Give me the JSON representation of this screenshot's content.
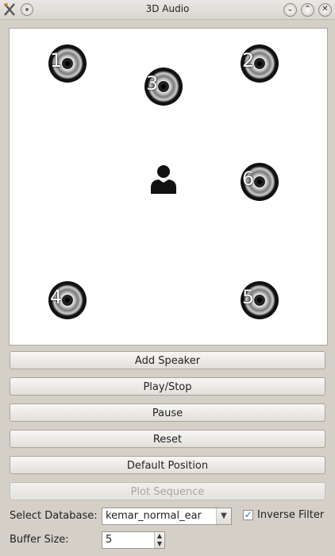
{
  "window": {
    "title": "3D Audio",
    "buttons": {
      "minimize": "⌄",
      "maximize": "⌃",
      "close": "✕"
    }
  },
  "canvas": {
    "speakers": [
      {
        "label": "1"
      },
      {
        "label": "2"
      },
      {
        "label": "3"
      },
      {
        "label": "4"
      },
      {
        "label": "5"
      },
      {
        "label": "6"
      }
    ],
    "listener_icon": "person-icon"
  },
  "buttons": {
    "add_speaker": "Add Speaker",
    "play_stop": "Play/Stop",
    "pause": "Pause",
    "reset": "Reset",
    "default_position": "Default Position",
    "plot_sequence": "Plot Sequence"
  },
  "database": {
    "label": "Select Database:",
    "selected": "kemar_normal_ear"
  },
  "inverse_filter": {
    "label": "Inverse Filter",
    "checked": true
  },
  "buffer": {
    "label": "Buffer Size:",
    "value": "5"
  },
  "colors": {
    "window_bg": "#d4d0c8",
    "canvas_bg": "#ffffff",
    "accent": "#2a6cc7"
  }
}
